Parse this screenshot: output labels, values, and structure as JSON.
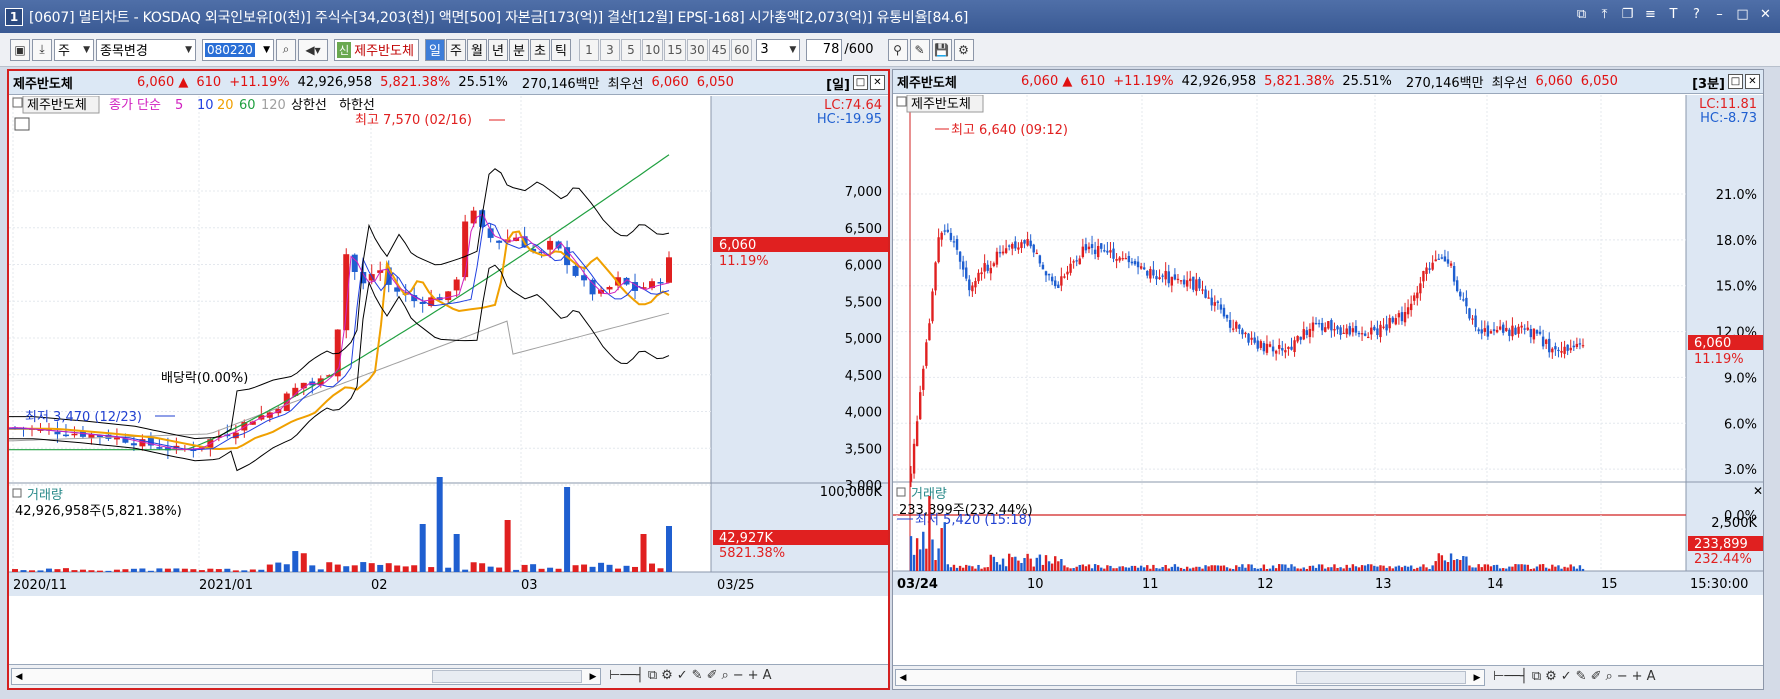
{
  "window": {
    "number": "1",
    "title": "[0607] 멀티차트 - KOSDAQ 외국인보유[0(천)] 주식수[34,203(천)] 액면[500] 자본금[173(억)] 결산[12월] EPS[-168] 시가총액[2,073(억)] 유통비율[84.6]"
  },
  "toolbar": {
    "market_select": "주",
    "menu_select": "종목변경",
    "code": "080220",
    "stock_badge": "신",
    "stock_name": "제주반도체",
    "periods": [
      "일",
      "주",
      "월",
      "년",
      "분",
      "초",
      "틱"
    ],
    "active_period": "일",
    "numbers": [
      "1",
      "3",
      "5",
      "10",
      "15",
      "30",
      "45",
      "60"
    ],
    "number_select": "3",
    "count": "78",
    "count_total": "/600"
  },
  "left_chart": {
    "header": {
      "name": "제주반도체",
      "price": "6,060",
      "change": "610",
      "change_pct": "+11.19%",
      "volume": "42,926,958",
      "volume_pct": "5,821.38%",
      "turnover": "25.51%",
      "amount": "270,146백만",
      "best_label": "최우선",
      "ask": "6,060",
      "bid": "6,050",
      "period": "[일]"
    },
    "legend": {
      "stock": "제주반도체",
      "ma_label": "종가 단순",
      "ma_values": [
        "5",
        "10",
        "20",
        "60",
        "120"
      ],
      "upper": "상한선",
      "lower": "하한선"
    },
    "annotations": {
      "high": "최고 7,570 (02/16)",
      "low": "최저 3,470 (12/23)",
      "dividend": "배당락(0.00%)"
    },
    "right_labels": {
      "lc": "LC:74.64",
      "hc": "HC:-19.95",
      "price": "6,060",
      "pct": "11.19%"
    },
    "y_ticks": [
      "7,000",
      "6,500",
      "6,000",
      "5,500",
      "5,000",
      "4,500",
      "4,000",
      "3,500",
      "3,000"
    ],
    "volume": {
      "title": "거래량",
      "value": "42,926,958주(5,821.38%)",
      "max_tick": "100,000K",
      "last": "42,927K",
      "last_pct": "5821.38%"
    },
    "x_labels": [
      "2020/11",
      "2021/01",
      "02",
      "03"
    ],
    "x_end": "03/25"
  },
  "right_chart": {
    "header": {
      "name": "제주반도체",
      "price": "6,060",
      "change": "610",
      "change_pct": "+11.19%",
      "volume": "42,926,958",
      "volume_pct": "5,821.38%",
      "turnover": "25.51%",
      "amount": "270,146백만",
      "best_label": "최우선",
      "ask": "6,060",
      "bid": "6,050",
      "period": "[3분]"
    },
    "legend": {
      "stock": "제주반도체"
    },
    "annotations": {
      "high": "최고 6,640 (09:12)",
      "low": "최저 5,420 (15:18)"
    },
    "right_labels": {
      "lc": "LC:11.81",
      "hc": "HC:-8.73",
      "price": "6,060",
      "pct": "11.19%"
    },
    "y_ticks": [
      "21.0%",
      "18.0%",
      "15.0%",
      "12.0%",
      "9.0%",
      "6.0%",
      "3.0%",
      "0.0%"
    ],
    "volume": {
      "title": "거래량",
      "value": "233,899주(232.44%)",
      "max_tick": "2,500K",
      "last": "233,899",
      "last_pct": "232.44%"
    },
    "x_labels": [
      "03/24",
      "10",
      "11",
      "12",
      "13",
      "14",
      "15"
    ],
    "x_end": "15:30:00"
  },
  "colors": {
    "up": "#e02020",
    "down": "#1f5fd0",
    "ma5": "#d020c0",
    "ma10": "#2040e0",
    "ma20": "#f0a000",
    "ma60": "#20a040",
    "ma120": "#a0a0a0"
  }
}
